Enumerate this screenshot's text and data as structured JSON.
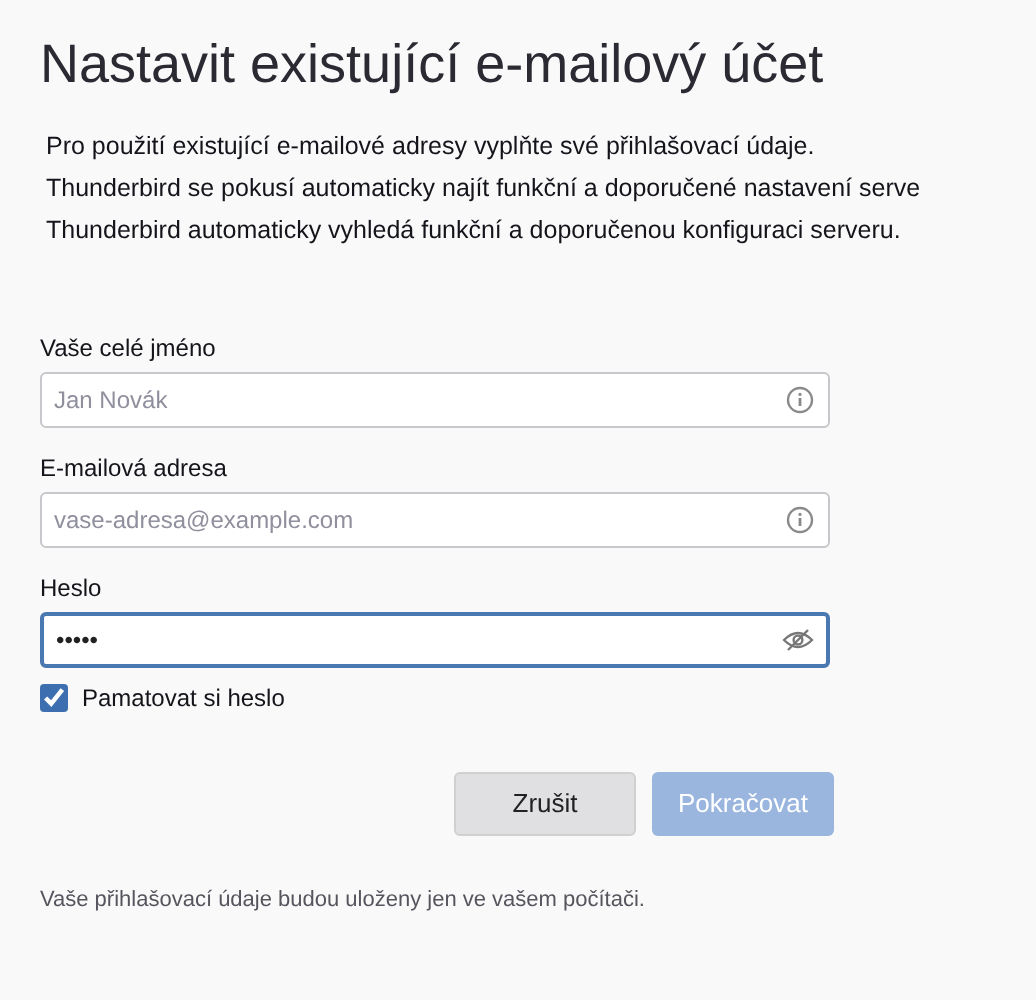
{
  "title": "Nastavit existující e-mailový účet",
  "intro": [
    "Pro použití existující e-mailové adresy vyplňte své přihlašovací údaje.",
    "Thunderbird se pokusí automaticky najít funkční a doporučené nastavení serve",
    "Thunderbird automaticky vyhledá funkční a doporučenou konfiguraci serveru."
  ],
  "fields": [
    {
      "label": "Vaše celé jméno",
      "placeholder": "Jan Novák",
      "kind": "info",
      "focused": false
    },
    {
      "label": "E-mailová adresa",
      "placeholder": "vase-adresa@example.com",
      "kind": "info",
      "focused": false
    },
    {
      "label": "Heslo",
      "value": "•••••",
      "kind": "password",
      "focused": true
    }
  ],
  "remember": {
    "label": "Pamatovat si heslo",
    "checked": true
  },
  "buttons": [
    {
      "label": "Zrušit",
      "disabled": false
    },
    {
      "label": "Pokračovat",
      "disabled": true
    }
  ],
  "footer": "Vaše přihlašovací údaje budou uloženy jen ve vašem počítači."
}
